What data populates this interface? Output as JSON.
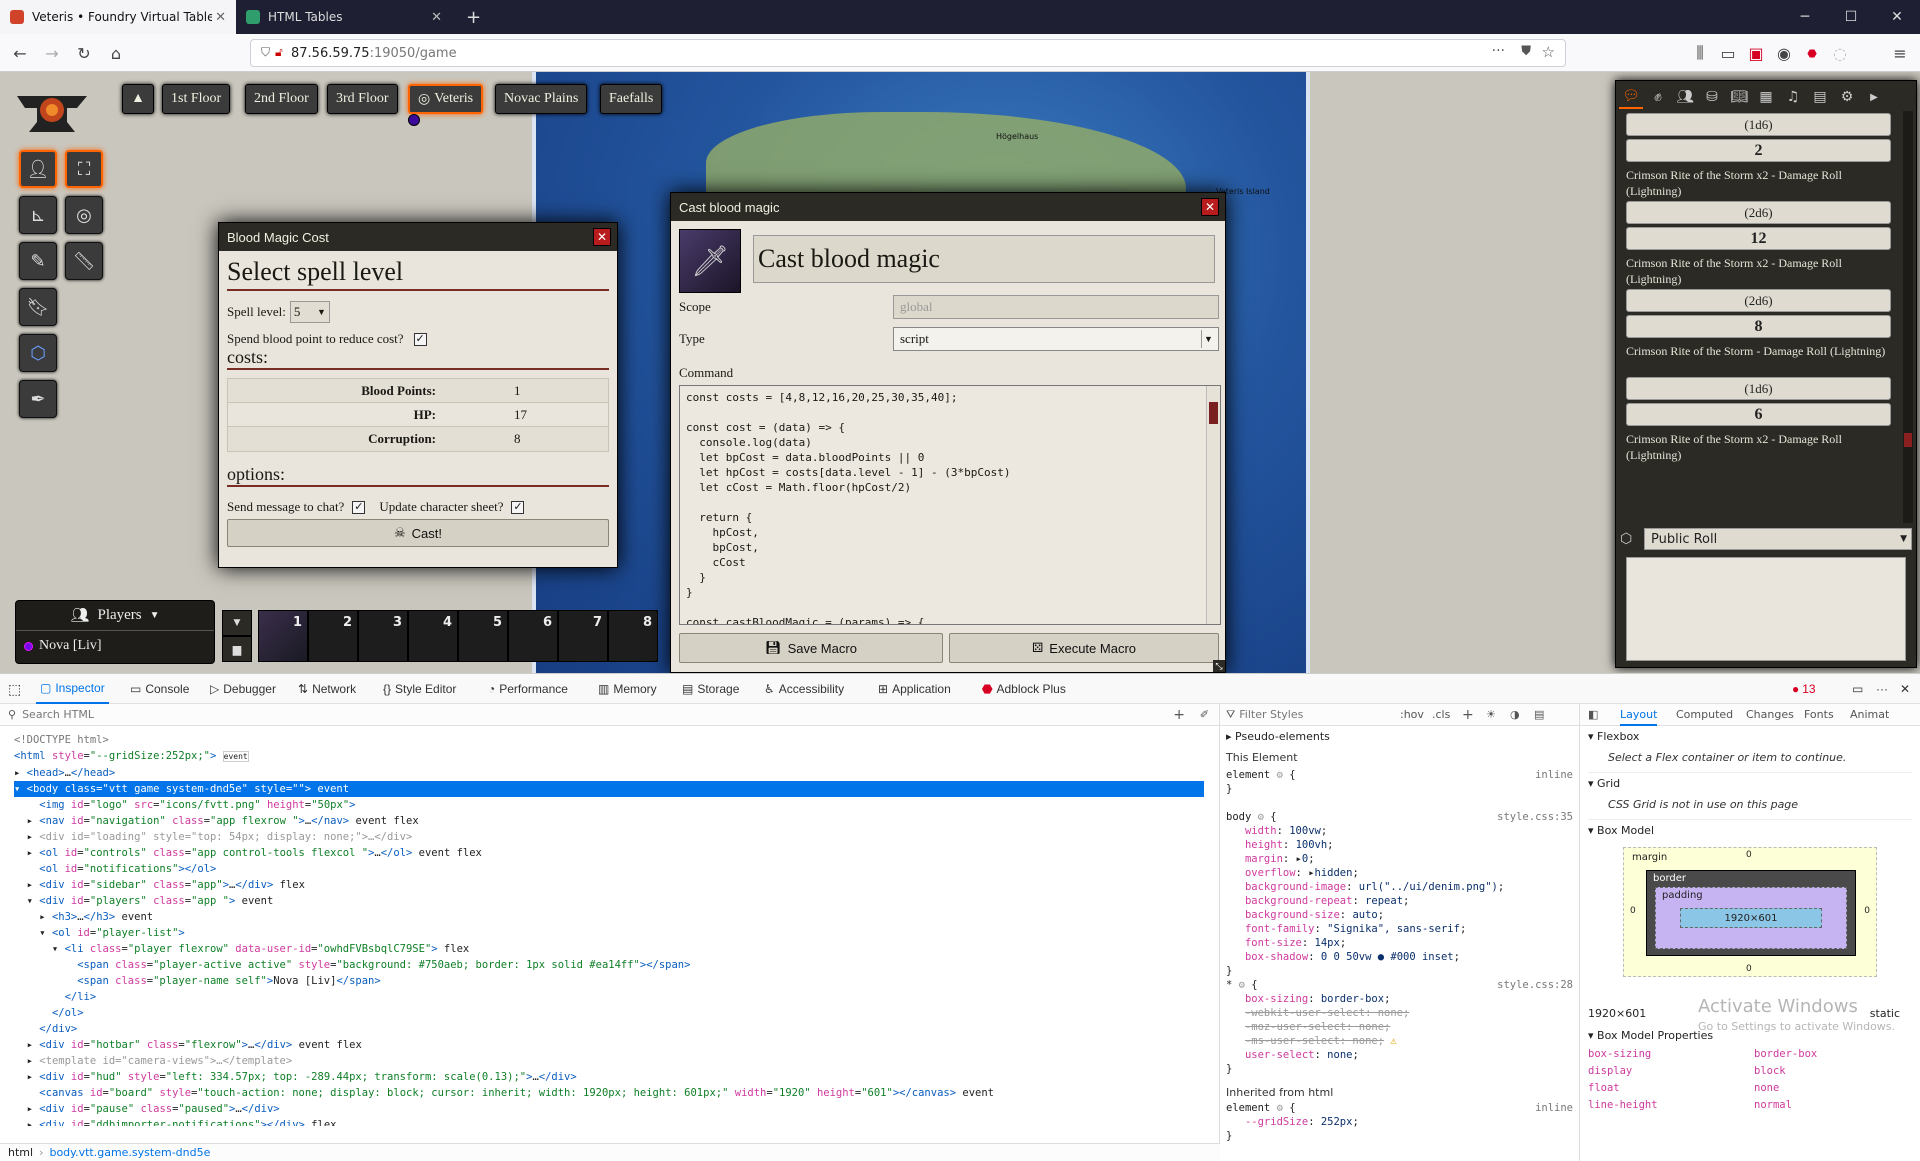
{
  "browser": {
    "tabs": [
      {
        "title": "Veteris • Foundry Virtual Tablet..."
      },
      {
        "title": "HTML Tables"
      }
    ],
    "url_host": "87.56.59.75",
    "url_rest": ":19050/game",
    "win_min": "─",
    "win_max": "☐",
    "win_close": "✕"
  },
  "game": {
    "scene_nav": [
      "1st Floor",
      "2nd Floor",
      "3rd Floor",
      "Veteris",
      "Novac Plains",
      "Faefalls"
    ],
    "nav_toggle": "▲",
    "map_labels": [
      "Högelhaus",
      "Veteris Island"
    ],
    "players": {
      "header": "Players",
      "list": [
        {
          "name": "Nova [Liv]",
          "color": "#750aeb"
        }
      ]
    },
    "hotbar": {
      "slots": [
        "1",
        "2",
        "3",
        "4",
        "5",
        "6",
        "7",
        "8"
      ]
    }
  },
  "blood_dialog": {
    "title": "Blood Magic Cost",
    "heading": "Select spell level",
    "spell_level_label": "Spell level:",
    "spell_level_value": "5",
    "spend_label": "Spend blood point to reduce cost?",
    "costs_heading": "costs:",
    "costs": [
      {
        "label": "Blood Points:",
        "value": "1"
      },
      {
        "label": "HP:",
        "value": "17"
      },
      {
        "label": "Corruption:",
        "value": "8"
      }
    ],
    "options_heading": "options:",
    "send_chat_label": "Send message to chat?",
    "update_sheet_label": "Update character sheet?",
    "cast_button": "Cast!"
  },
  "macro_dialog": {
    "title": "Cast blood magic",
    "name_value": "Cast blood magic",
    "scope_label": "Scope",
    "scope_value": "global",
    "type_label": "Type",
    "type_value": "script",
    "command_label": "Command",
    "code": "const costs = [4,8,12,16,20,25,30,35,40];\n\nconst cost = (data) => {\n  console.log(data)\n  let bpCost = data.bloodPoints || 0\n  let hpCost = costs[data.level - 1] - (3*bpCost)\n  let cCost = Math.floor(hpCost/2)\n\n  return {\n    hpCost,\n    bpCost,\n    cCost\n  }\n}\n\nconst castBloodMagic = (params) => {",
    "save_button": "Save Macro",
    "execute_button": "Execute Macro"
  },
  "chat": {
    "messages": [
      {
        "formula": "(1d6)",
        "result": "2"
      },
      {
        "flavor": "Crimson Rite of the Storm x2 - Damage Roll (Lightning)",
        "formula": "(2d6)",
        "result": "12"
      },
      {
        "flavor": "Crimson Rite of the Storm x2 - Damage Roll (Lightning)",
        "formula": "(2d6)",
        "result": "8"
      },
      {
        "flavor": "Crimson Rite of the Storm - Damage Roll (Lightning)",
        "formula": "(1d6)",
        "result": "6"
      },
      {
        "flavor": "Crimson Rite of the Storm x2 - Damage Roll (Lightning)"
      }
    ],
    "roll_mode": "Public Roll"
  },
  "devtools": {
    "tabs": [
      "Inspector",
      "Console",
      "Debugger",
      "Network",
      "Style Editor",
      "Performance",
      "Memory",
      "Storage",
      "Accessibility",
      "Application",
      "Adblock Plus"
    ],
    "error_count": "13",
    "search_placeholder": "Search HTML",
    "filter_placeholder": "Filter Styles",
    "hov": ":hov",
    "cls": ".cls",
    "layout_tabs": [
      "Layout",
      "Computed",
      "Changes",
      "Fonts",
      "Animat"
    ],
    "breadcrumb_root": "html",
    "breadcrumb_current": "body.vtt.game.system-dnd5e",
    "pseudo": "Pseudo-elements",
    "this_element": "This Element",
    "inherited": "Inherited from html",
    "flexbox_title": "Flexbox",
    "flexbox_msg": "Select a Flex container or item to continue.",
    "grid_title": "Grid",
    "grid_msg": "CSS Grid is not in use on this page",
    "boxmodel_title": "Box Model",
    "bm_margin": "margin",
    "bm_border": "border",
    "bm_padding": "padding",
    "bm_zero": "0",
    "bm_content": "1920×601",
    "bm_dims": "1920×601",
    "bm_position": "static",
    "bm_props_title": "Box Model Properties",
    "bm_props": [
      {
        "name": "box-sizing",
        "value": "border-box"
      },
      {
        "name": "display",
        "value": "block"
      },
      {
        "name": "float",
        "value": "none"
      },
      {
        "name": "line-height",
        "value": "normal"
      }
    ],
    "watermark": "Activate Windows",
    "watermark2": "Go to Settings to activate Windows."
  }
}
